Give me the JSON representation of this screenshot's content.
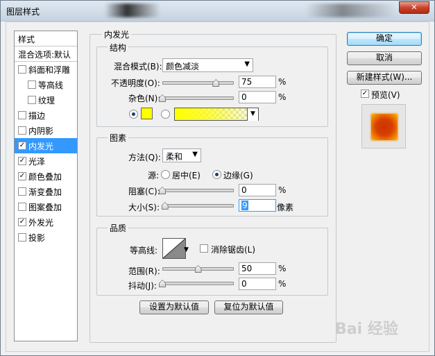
{
  "window": {
    "title": "图层样式"
  },
  "sidebar": {
    "header": "样式",
    "blending_options": "混合选项:默认",
    "items": [
      {
        "label": "斜面和浮雕",
        "checked": false,
        "indent": false,
        "selected": false
      },
      {
        "label": "等高线",
        "checked": false,
        "indent": true,
        "selected": false
      },
      {
        "label": "纹理",
        "checked": false,
        "indent": true,
        "selected": false
      },
      {
        "label": "描边",
        "checked": false,
        "indent": false,
        "selected": false
      },
      {
        "label": "内阴影",
        "checked": false,
        "indent": false,
        "selected": false
      },
      {
        "label": "内发光",
        "checked": true,
        "indent": false,
        "selected": true
      },
      {
        "label": "光泽",
        "checked": true,
        "indent": false,
        "selected": false
      },
      {
        "label": "颜色叠加",
        "checked": true,
        "indent": false,
        "selected": false
      },
      {
        "label": "渐变叠加",
        "checked": false,
        "indent": false,
        "selected": false
      },
      {
        "label": "图案叠加",
        "checked": false,
        "indent": false,
        "selected": false
      },
      {
        "label": "外发光",
        "checked": true,
        "indent": false,
        "selected": false
      },
      {
        "label": "投影",
        "checked": false,
        "indent": false,
        "selected": false
      }
    ]
  },
  "panel": {
    "title": "内发光",
    "structure": {
      "legend": "结构",
      "blend_mode_label": "混合模式(B):",
      "blend_mode_value": "颜色减淡",
      "opacity_label": "不透明度(O):",
      "opacity_value": "75",
      "opacity_level": 0.75,
      "noise_label": "杂色(N):",
      "noise_value": "0",
      "noise_level": 0,
      "percent": "%",
      "color_mode": "solid",
      "color": "#ffff00"
    },
    "elements": {
      "legend": "图素",
      "technique_label": "方法(Q):",
      "technique_value": "柔和",
      "source_label": "源:",
      "source_center": "居中(E)",
      "source_edge": "边缘(G)",
      "source_selected": "edge",
      "choke_label": "阻塞(C):",
      "choke_value": "0",
      "choke_level": 0,
      "size_label": "大小(S):",
      "size_value": "9",
      "size_unit": "像素",
      "size_level": 0.036,
      "percent": "%"
    },
    "quality": {
      "legend": "品质",
      "contour_label": "等高线:",
      "antialias_label": "消除锯齿(L)",
      "antialias_checked": false,
      "range_label": "范围(R):",
      "range_value": "50",
      "range_level": 0.5,
      "jitter_label": "抖动(J):",
      "jitter_value": "0",
      "jitter_level": 0,
      "percent": "%"
    },
    "make_default": "设置为默认值",
    "reset_default": "复位为默认值"
  },
  "actions": {
    "ok": "确定",
    "cancel": "取消",
    "new_style": "新建样式(W)...",
    "preview_label": "预览(V)",
    "preview_checked": true
  },
  "watermark": "Bai 经验"
}
